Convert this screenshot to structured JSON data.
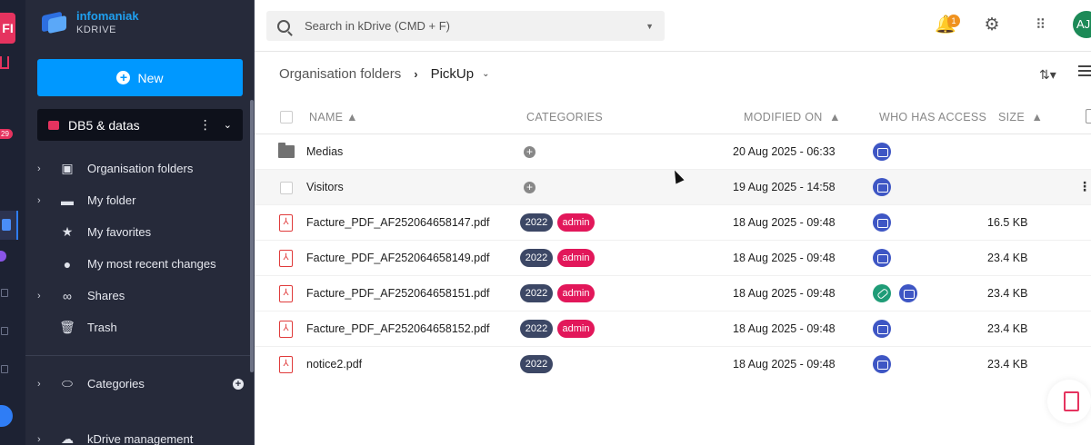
{
  "rail": {
    "top_label": "FI",
    "badge": "29"
  },
  "brand": {
    "name": "infomaniak",
    "product": "KDRIVE"
  },
  "sidebar": {
    "new_label": "New",
    "drive_name": "DB5 & datas",
    "items": [
      {
        "label": "Organisation folders",
        "icon": "org-folder-icon",
        "expandable": true
      },
      {
        "label": "My folder",
        "icon": "folder-icon",
        "expandable": true
      },
      {
        "label": "My favorites",
        "icon": "star-icon",
        "expandable": false
      },
      {
        "label": "My most recent changes",
        "icon": "clock-icon",
        "expandable": false
      },
      {
        "label": "Shares",
        "icon": "link-icon",
        "expandable": true
      },
      {
        "label": "Trash",
        "icon": "trash-icon",
        "expandable": false
      }
    ],
    "categories_label": "Categories",
    "management_label": "kDrive management"
  },
  "topbar": {
    "search_placeholder": "Search in kDrive (CMD + F)",
    "notifications_count": "1",
    "avatar_initials": "AJ"
  },
  "breadcrumb": {
    "parent": "Organisation folders",
    "current": "PickUp"
  },
  "table": {
    "headers": {
      "name": "NAME",
      "categories": "CATEGORIES",
      "modified": "MODIFIED ON",
      "access": "WHO HAS ACCESS",
      "size": "SIZE"
    },
    "rows": [
      {
        "type": "folder",
        "name": "Medias",
        "tags": [],
        "modified": "20 Aug 2025 - 06:33",
        "access": [
          "drive"
        ],
        "size": ""
      },
      {
        "type": "folder-empty",
        "name": "Visitors",
        "tags": [],
        "modified": "19 Aug 2025 - 14:58",
        "access": [
          "drive"
        ],
        "size": ""
      },
      {
        "type": "pdf",
        "name": "Facture_PDF_AF252064658147.pdf",
        "tags": [
          "2022",
          "admin"
        ],
        "modified": "18 Aug 2025 - 09:48",
        "access": [
          "drive"
        ],
        "size": "16.5 KB"
      },
      {
        "type": "pdf",
        "name": "Facture_PDF_AF252064658149.pdf",
        "tags": [
          "2022",
          "admin"
        ],
        "modified": "18 Aug 2025 - 09:48",
        "access": [
          "drive"
        ],
        "size": "23.4 KB"
      },
      {
        "type": "pdf",
        "name": "Facture_PDF_AF252064658151.pdf",
        "tags": [
          "2022",
          "admin"
        ],
        "modified": "18 Aug 2025 - 09:48",
        "access": [
          "link",
          "drive"
        ],
        "size": "23.4 KB"
      },
      {
        "type": "pdf",
        "name": "Facture_PDF_AF252064658152.pdf",
        "tags": [
          "2022",
          "admin"
        ],
        "modified": "18 Aug 2025 - 09:48",
        "access": [
          "drive"
        ],
        "size": "23.4 KB"
      },
      {
        "type": "pdf",
        "name": "notice2.pdf",
        "tags": [
          "2022"
        ],
        "modified": "18 Aug 2025 - 09:48",
        "access": [
          "drive"
        ],
        "size": "23.4 KB"
      }
    ]
  },
  "colors": {
    "accent": "#0098ff",
    "pink": "#e2175a",
    "tag_dark": "#3c4765",
    "sidebar_bg": "#262a3a"
  }
}
